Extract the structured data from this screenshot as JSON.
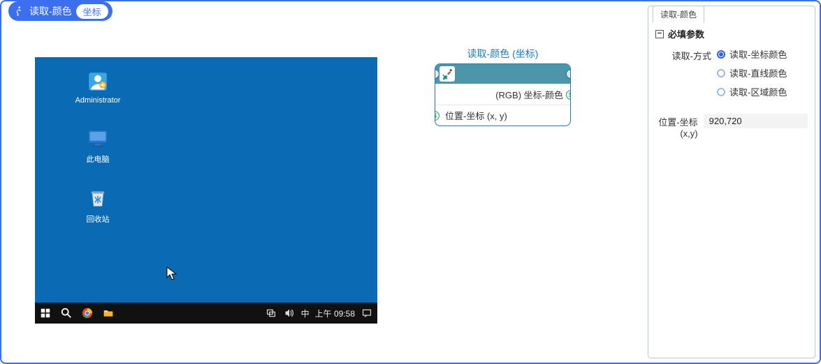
{
  "header": {
    "title": "读取-颜色",
    "pill": "坐标"
  },
  "desktop": {
    "icons": {
      "admin": "Administrator",
      "pc": "此电脑",
      "bin": "回收站"
    },
    "taskbar": {
      "ime": "中",
      "time": "上午 09:58"
    }
  },
  "node": {
    "title": "读取-颜色 (坐标)",
    "row_rgb": "(RGB) 坐标-颜色",
    "row_pos": "位置-坐标 (x, y)"
  },
  "panel": {
    "tab": "读取-颜色",
    "group": "必填参数",
    "method_label": "读取-方式",
    "options": {
      "coord": "读取-坐标颜色",
      "line": "读取-直线颜色",
      "area": "读取-区域颜色"
    },
    "pos_label": "位置-坐标(x,y)",
    "pos_value": "920,720"
  }
}
